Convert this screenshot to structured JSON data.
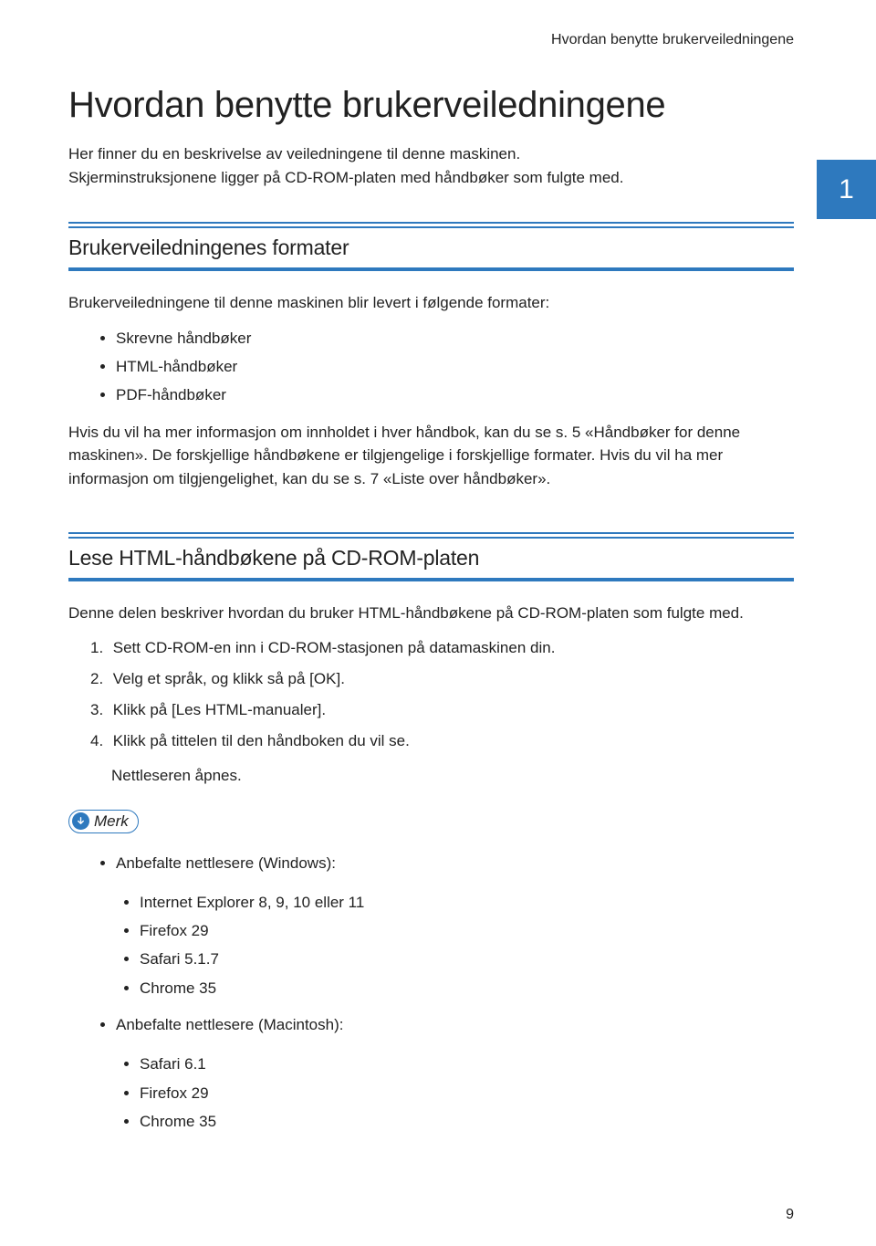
{
  "running_head": "Hvordan benytte brukerveiledningene",
  "chapter_number": "1",
  "title": "Hvordan benytte brukerveiledningene",
  "intro": "Her finner du en beskrivelse av veiledningene til denne maskinen. Skjerminstruksjonene ligger på CD-ROM-platen med håndbøker som fulgte med.",
  "section1": {
    "heading": "Brukerveiledningenes formater",
    "lead": "Brukerveiledningene til denne maskinen blir levert i følgende formater:",
    "items": [
      "Skrevne håndbøker",
      "HTML-håndbøker",
      "PDF-håndbøker"
    ],
    "tail": "Hvis du vil ha mer informasjon om innholdet i hver håndbok, kan du se s. 5 «Håndbøker for denne maskinen». De forskjellige håndbøkene er tilgjengelige i forskjellige formater. Hvis du vil ha mer informasjon om tilgjengelighet, kan du se s. 7 «Liste over håndbøker»."
  },
  "section2": {
    "heading": "Lese HTML-håndbøkene på CD-ROM-platen",
    "lead": "Denne delen beskriver hvordan du bruker HTML-håndbøkene på CD-ROM-platen som fulgte med.",
    "steps": [
      "Sett CD-ROM-en inn i CD-ROM-stasjonen på datamaskinen din.",
      "Velg et språk, og klikk så på [OK].",
      "Klikk på [Les HTML-manualer].",
      "Klikk på tittelen til den håndboken du vil se."
    ],
    "after_steps": "Nettleseren åpnes.",
    "note_label": "Merk",
    "note_groups": [
      {
        "heading": "Anbefalte nettlesere (Windows):",
        "items": [
          "Internet Explorer 8, 9, 10 eller 11",
          "Firefox 29",
          "Safari 5.1.7",
          "Chrome 35"
        ]
      },
      {
        "heading": "Anbefalte nettlesere (Macintosh):",
        "items": [
          "Safari 6.1",
          "Firefox 29",
          "Chrome 35"
        ]
      }
    ]
  },
  "page_number": "9"
}
